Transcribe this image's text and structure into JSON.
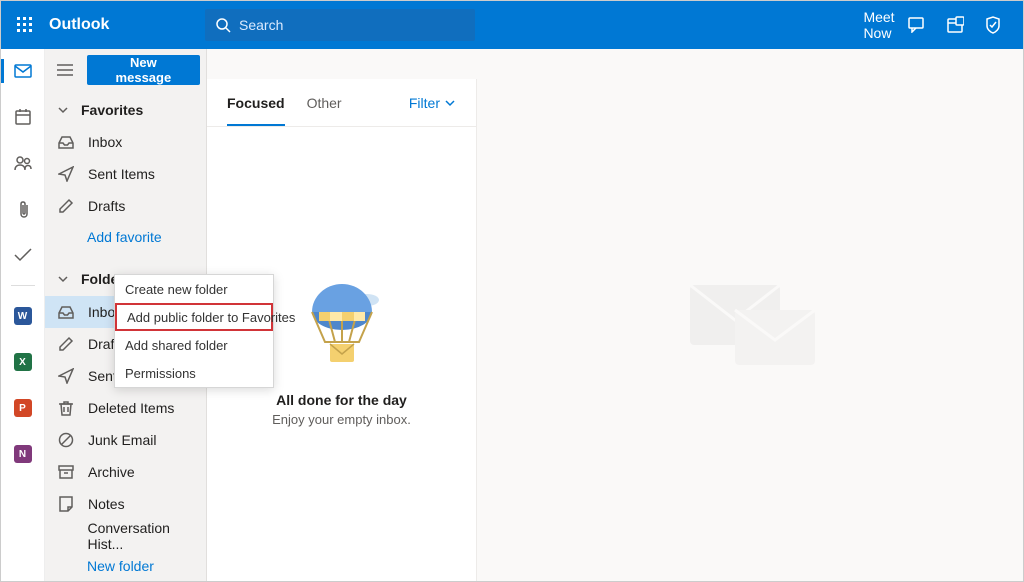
{
  "header": {
    "app_title": "Outlook",
    "search_placeholder": "Search",
    "meet_now": "Meet Now"
  },
  "nav": {
    "new_message": "New message",
    "favorites_label": "Favorites",
    "favorites": [
      {
        "label": "Inbox",
        "icon": "inbox"
      },
      {
        "label": "Sent Items",
        "icon": "send"
      },
      {
        "label": "Drafts",
        "icon": "draft"
      }
    ],
    "add_favorite": "Add favorite",
    "folders_label": "Folders",
    "folders": [
      {
        "label": "Inbox",
        "icon": "inbox",
        "selected": true
      },
      {
        "label": "Drafts",
        "icon": "draft"
      },
      {
        "label": "Sent It",
        "icon": "send"
      },
      {
        "label": "Deleted Items",
        "icon": "trash"
      },
      {
        "label": "Junk Email",
        "icon": "block"
      },
      {
        "label": "Archive",
        "icon": "archive"
      },
      {
        "label": "Notes",
        "icon": "note"
      },
      {
        "label": "Conversation Hist...",
        "icon": "none"
      }
    ],
    "new_folder": "New folder"
  },
  "context_menu": [
    {
      "label": "Create new folder"
    },
    {
      "label": "Add public folder to Favorites",
      "highlight": true
    },
    {
      "label": "Add shared folder"
    },
    {
      "label": "Permissions"
    }
  ],
  "listpane": {
    "tab_focused": "Focused",
    "tab_other": "Other",
    "filter": "Filter",
    "empty_title": "All done for the day",
    "empty_sub": "Enjoy your empty inbox."
  }
}
